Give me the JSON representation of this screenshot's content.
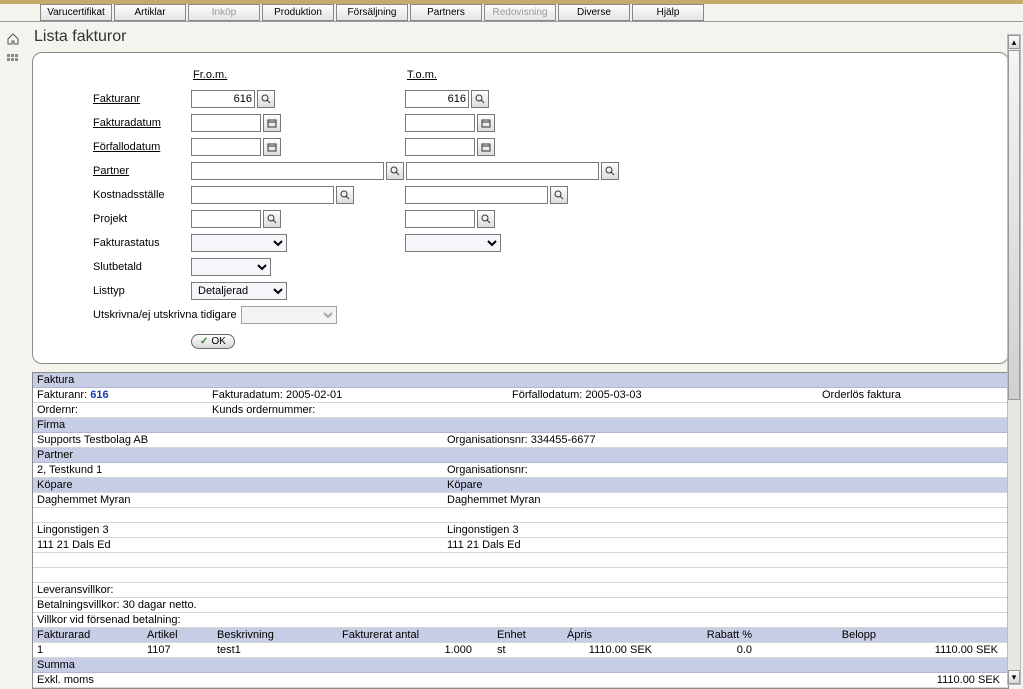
{
  "tabs": [
    {
      "label": "Varucertifikat",
      "disabled": false
    },
    {
      "label": "Artiklar",
      "disabled": false
    },
    {
      "label": "Inköp",
      "disabled": true
    },
    {
      "label": "Produktion",
      "disabled": false
    },
    {
      "label": "Försäljning",
      "disabled": false
    },
    {
      "label": "Partners",
      "disabled": false
    },
    {
      "label": "Redovisning",
      "disabled": true
    },
    {
      "label": "Diverse",
      "disabled": false
    },
    {
      "label": "Hjälp",
      "disabled": false
    }
  ],
  "page_title": "Lista fakturor",
  "filter": {
    "head_from": "Fr.o.m.",
    "head_to": "T.o.m.",
    "labels": {
      "fakturanr": "Fakturanr",
      "fakturadatum": "Fakturadatum",
      "forfallodatum": "Förfallodatum",
      "partner": "Partner",
      "kostnadsstalle": "Kostnadsställe",
      "projekt": "Projekt",
      "fakturastatus": "Fakturastatus",
      "slutbetald": "Slutbetald",
      "listtyp": "Listtyp",
      "utskrivna": "Utskrivna/ej utskrivna tidigare"
    },
    "values": {
      "fakturanr_from": "616",
      "fakturanr_to": "616",
      "fakturadatum_from": "",
      "fakturadatum_to": "",
      "forfallodatum_from": "",
      "forfallodatum_to": "",
      "partner_from": "",
      "partner_to": "",
      "kostnadsstalle_from": "",
      "kostnadsstalle_to": "",
      "projekt_from": "",
      "projekt_to": "",
      "fakturastatus_from": "",
      "fakturastatus_to": "",
      "slutbetald": "",
      "listtyp": "Detaljerad",
      "utskrivna": ""
    },
    "ok": "OK"
  },
  "invoice": {
    "section_faktura": "Faktura",
    "fakturanr_label": "Fakturanr:",
    "fakturanr_value": "616",
    "fakturadatum_label": "Fakturadatum:",
    "fakturadatum_value": "2005-02-01",
    "forfallodatum_label": "Förfallodatum:",
    "forfallodatum_value": "2005-03-03",
    "orderlos": "Orderlös faktura",
    "ordernr_label": "Ordernr:",
    "kunds_order_label": "Kunds ordernummer:",
    "section_firma": "Firma",
    "firma_name": "Supports Testbolag AB",
    "orgnr_label": "Organisationsnr:",
    "firma_orgnr": "334455-6677",
    "section_partner": "Partner",
    "partner_name": "2, Testkund 1",
    "partner_orgnr_label": "Organisationsnr:",
    "kopare_left": "Köpare",
    "kopare_right": "Köpare",
    "buyer_left_name": "Daghemmet Myran",
    "buyer_right_name": "Daghemmet Myran",
    "addr_left_1": "Lingonstigen 3",
    "addr_left_2": "111 21 Dals Ed",
    "addr_right_1": "Lingonstigen 3",
    "addr_right_2": "111 21 Dals Ed",
    "leveransvillkor_label": "Leveransvillkor:",
    "betalningsvillkor_label": "Betalningsvillkor:",
    "betalningsvillkor_value": "30 dagar netto.",
    "villkor_forsenad": "Villkor vid försenad betalning:",
    "grid_headers": {
      "fakturarad": "Fakturarad",
      "artikel": "Artikel",
      "beskrivning": "Beskrivning",
      "antal": "Fakturerat antal",
      "enhet": "Enhet",
      "apris": "Ápris",
      "rabatt": "Rabatt %",
      "belopp": "Belopp"
    },
    "line": {
      "rad": "1",
      "artikel": "1107",
      "beskrivning": "test1",
      "antal": "1.000",
      "enhet": "st",
      "apris": "1110.00 SEK",
      "rabatt": "0.0",
      "belopp": "1110.00 SEK"
    },
    "summa": "Summa",
    "exkl_moms_label": "Exkl. moms",
    "exkl_moms_value": "1110.00 SEK"
  }
}
